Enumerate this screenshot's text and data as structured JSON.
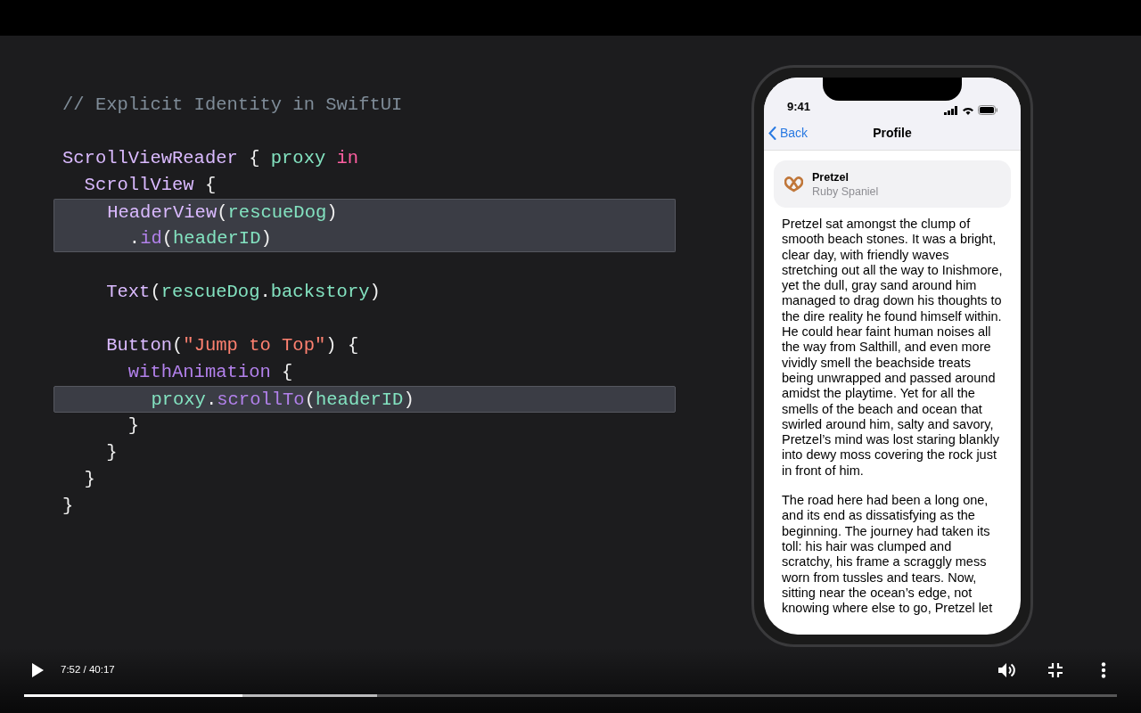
{
  "code": {
    "lines": [
      {
        "highlighted": false,
        "tokens": [
          {
            "kind": "comment",
            "text": "// Explicit Identity in SwiftUI"
          }
        ]
      },
      {
        "highlighted": false
      },
      {
        "highlighted": false,
        "tokens": [
          {
            "kind": "type",
            "text": "ScrollViewReader"
          },
          {
            "kind": "plain",
            "text": " { "
          },
          {
            "kind": "var",
            "text": "proxy"
          },
          {
            "kind": "keyword",
            "text": " in"
          }
        ]
      },
      {
        "highlighted": false,
        "tokens": [
          {
            "kind": "type",
            "text": "  ScrollView"
          },
          {
            "kind": "plain",
            "text": " {"
          }
        ]
      },
      {
        "highlighted": true,
        "tokens": [
          {
            "kind": "type",
            "text": "    HeaderView"
          },
          {
            "kind": "plain",
            "text": "("
          },
          {
            "kind": "var",
            "text": "rescueDog"
          },
          {
            "kind": "plain",
            "text": ")"
          }
        ]
      },
      {
        "highlighted": true,
        "tokens": [
          {
            "kind": "plain",
            "text": "      ."
          },
          {
            "kind": "method",
            "text": "id"
          },
          {
            "kind": "plain",
            "text": "("
          },
          {
            "kind": "var",
            "text": "headerID"
          },
          {
            "kind": "plain",
            "text": ")"
          }
        ]
      },
      {
        "highlighted": false
      },
      {
        "highlighted": false,
        "tokens": [
          {
            "kind": "type",
            "text": "    Text"
          },
          {
            "kind": "plain",
            "text": "("
          },
          {
            "kind": "var",
            "text": "rescueDog"
          },
          {
            "kind": "plain",
            "text": "."
          },
          {
            "kind": "var",
            "text": "backstory"
          },
          {
            "kind": "plain",
            "text": ")"
          }
        ]
      },
      {
        "highlighted": false
      },
      {
        "highlighted": false,
        "tokens": [
          {
            "kind": "type",
            "text": "    Button"
          },
          {
            "kind": "plain",
            "text": "("
          },
          {
            "kind": "string",
            "text": "\"Jump to Top\""
          },
          {
            "kind": "plain",
            "text": ") {"
          }
        ]
      },
      {
        "highlighted": false,
        "tokens": [
          {
            "kind": "method",
            "text": "      withAnimation"
          },
          {
            "kind": "plain",
            "text": " {"
          }
        ]
      },
      {
        "highlighted": true,
        "tokens": [
          {
            "kind": "var",
            "text": "        proxy"
          },
          {
            "kind": "plain",
            "text": "."
          },
          {
            "kind": "method",
            "text": "scrollTo"
          },
          {
            "kind": "plain",
            "text": "("
          },
          {
            "kind": "var",
            "text": "headerID"
          },
          {
            "kind": "plain",
            "text": ")"
          }
        ]
      },
      {
        "highlighted": false,
        "tokens": [
          {
            "kind": "plain",
            "text": "      }"
          }
        ]
      },
      {
        "highlighted": false,
        "tokens": [
          {
            "kind": "plain",
            "text": "    }"
          }
        ]
      },
      {
        "highlighted": false,
        "tokens": [
          {
            "kind": "plain",
            "text": "  }"
          }
        ]
      },
      {
        "highlighted": false,
        "tokens": [
          {
            "kind": "plain",
            "text": "}"
          }
        ]
      }
    ]
  },
  "phone": {
    "status_bar": {
      "time": "9:41"
    },
    "nav_bar": {
      "back": "Back",
      "title": "Profile"
    },
    "header_card": {
      "name": "Pretzel",
      "breed": "Ruby Spaniel"
    },
    "paragraphs": [
      "Pretzel sat amongst the clump of smooth beach stones. It was a bright, clear day, with friendly waves stretching out all the way to Inishmore, yet the dull, gray sand around him managed to drag down his thoughts to the dire reality he found himself within. He could hear faint human noises all the way from Salthill, and even more vividly smell the beachside treats being unwrapped and passed around amidst the playtime. Yet for all the smells of the beach and ocean that swirled around him, salty and savory, Pretzel’s mind was lost staring blankly into dewy moss covering the rock just in front of him.",
      "The road here had been a long one, and its end as dissatisfying as the beginning. The journey had taken its toll: his hair was clumped and scratchy, his frame a scraggly mess worn from tussles and tears. Now, sitting near the ocean’s edge, not knowing where else to go, Pretzel let"
    ]
  },
  "player": {
    "playing": false,
    "time": "7:52 / 40:17",
    "progress": {
      "level": 0.2
    },
    "buffer": {
      "level": 0.323
    }
  }
}
